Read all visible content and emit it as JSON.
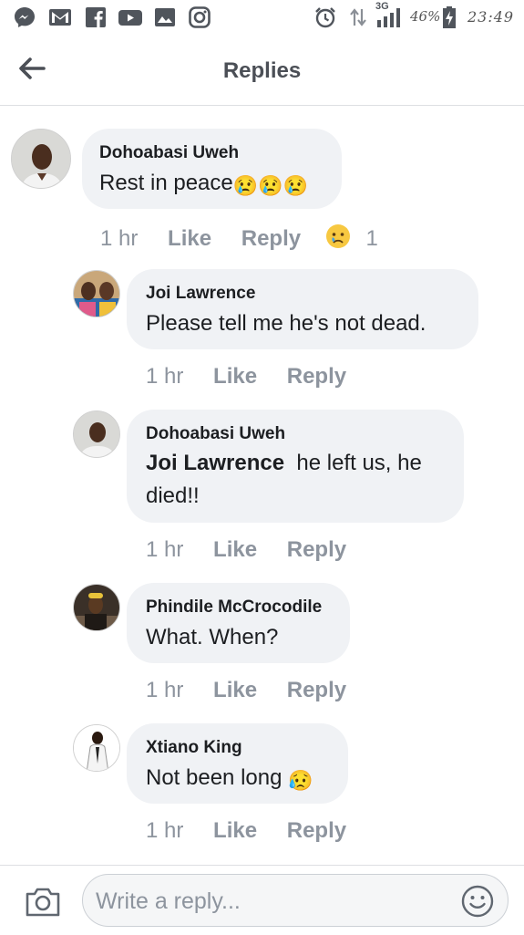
{
  "status_bar": {
    "battery": "46%",
    "network": "3G",
    "time": "23:49"
  },
  "header": {
    "title": "Replies"
  },
  "comments": [
    {
      "author": "Dohoabasi Uweh",
      "text": "Rest in peace",
      "emoji": "😢😢😢",
      "time": "1 hr",
      "like_label": "Like",
      "reply_label": "Reply",
      "reaction_count": "1"
    },
    {
      "author": "Joi Lawrence",
      "text": "Please tell me he's not dead.",
      "time": "1 hr",
      "like_label": "Like",
      "reply_label": "Reply"
    },
    {
      "author": "Dohoabasi Uweh",
      "mention": "Joi Lawrence",
      "text": "he left us, he",
      "text_line2": "died!!",
      "time": "1 hr",
      "like_label": "Like",
      "reply_label": "Reply"
    },
    {
      "author": "Phindile McCrocodile",
      "text": "What. When?",
      "time": "1 hr",
      "like_label": "Like",
      "reply_label": "Reply"
    },
    {
      "author": "Xtiano King",
      "text": "Not been long",
      "emoji": "😥",
      "time": "1 hr",
      "like_label": "Like",
      "reply_label": "Reply"
    }
  ],
  "composer": {
    "placeholder": "Write a reply..."
  },
  "colors": {
    "bubble": "#f0f2f5",
    "meta_text": "#8d949e",
    "title_text": "#4b4f56"
  }
}
